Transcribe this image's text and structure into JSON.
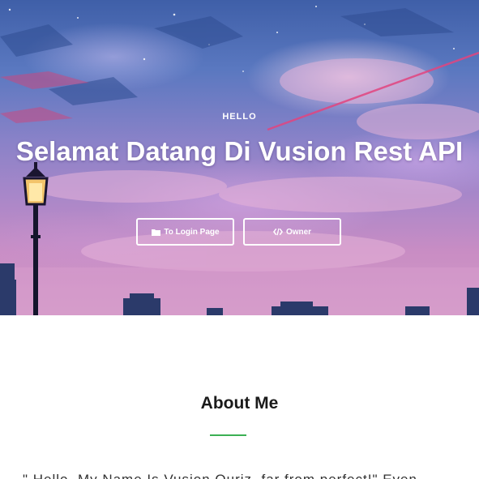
{
  "hero": {
    "greeting": "HELLO",
    "title": "Selamat Datang Di Vusion Rest API",
    "buttons": [
      {
        "label": "To Login Page",
        "icon": "folder-icon"
      },
      {
        "label": "Owner",
        "icon": "code-icon"
      }
    ]
  },
  "about": {
    "title": "About Me",
    "text": "\" Hello, My Name Is Vusion Quriz, far from perfect!\" Even",
    "accent_color": "#3cb054"
  }
}
